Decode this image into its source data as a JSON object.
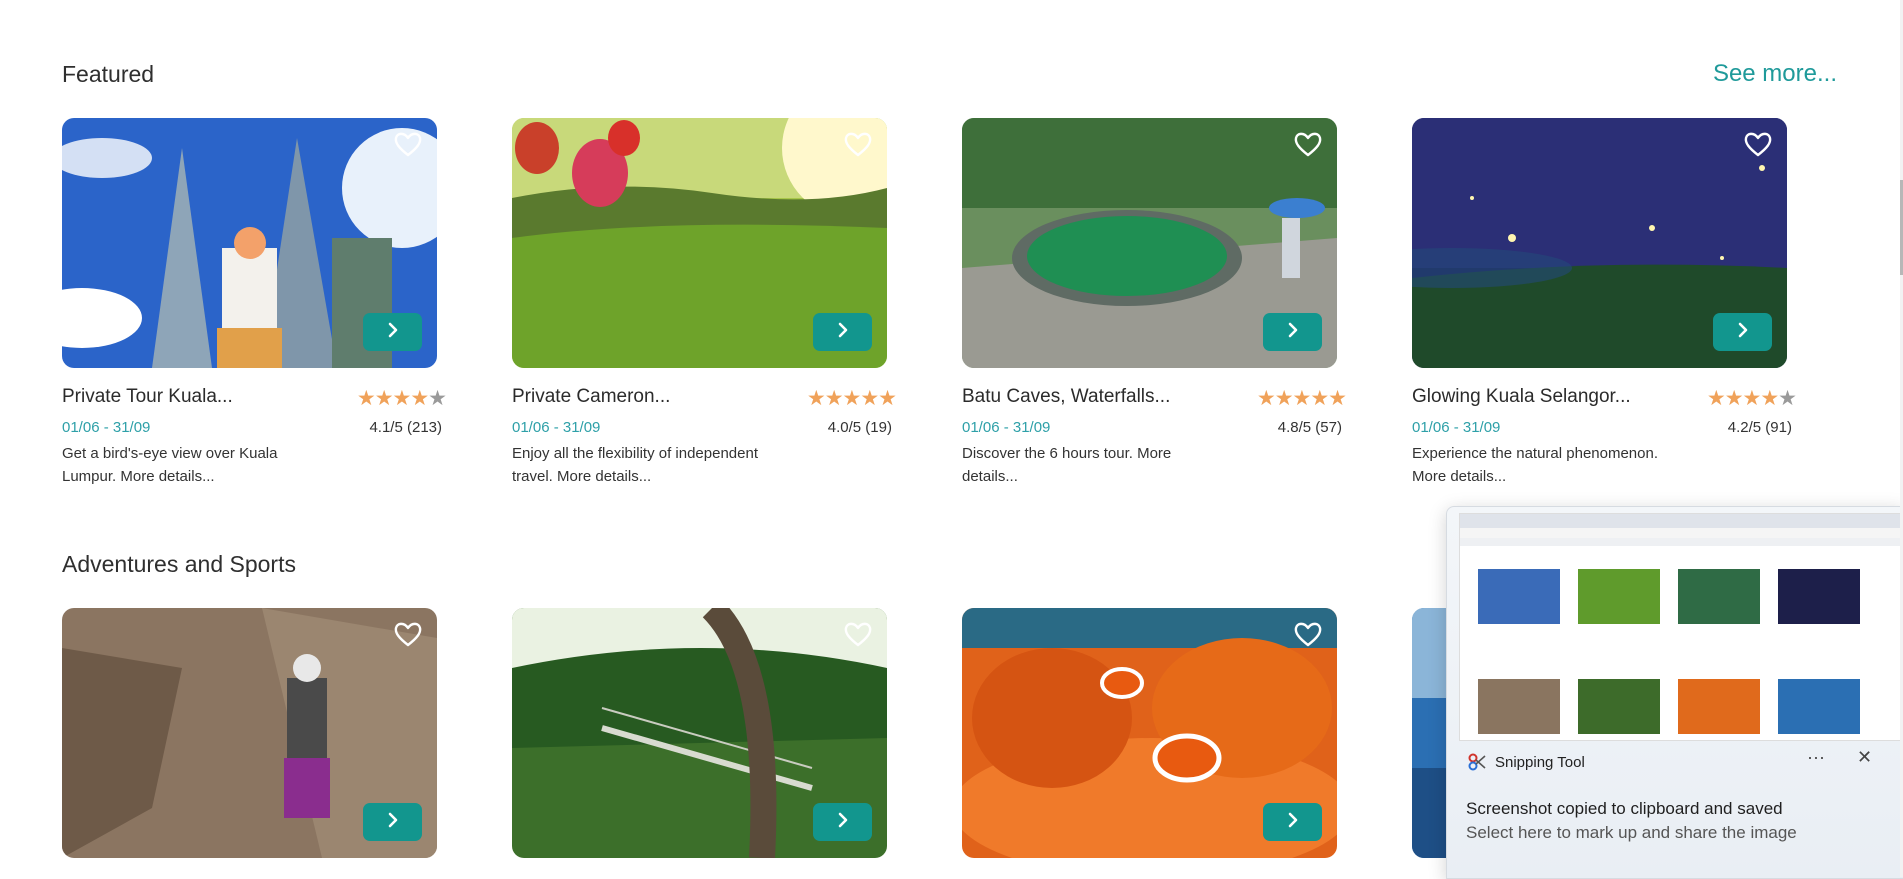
{
  "sections": [
    {
      "title": "Featured",
      "see_more": "See more..."
    },
    {
      "title": "Adventures and Sports"
    }
  ],
  "featured": [
    {
      "title": "Private Tour Kuala...",
      "dates": "01/06 - 31/09",
      "rating": "4.1/5 (213)",
      "stars": 4,
      "desc": "Get a bird's-eye view over Kuala Lumpur. More details...",
      "scene": "towers"
    },
    {
      "title": "Private Cameron...",
      "dates": "01/06 - 31/09",
      "rating": "4.0/5 (19)",
      "stars": 5,
      "desc": "Enjoy all the flexibility of independent travel. More details...",
      "scene": "tea"
    },
    {
      "title": "Batu Caves, Waterfalls...",
      "dates": "01/06 - 31/09",
      "rating": "4.8/5 (57)",
      "stars": 5,
      "desc": "Discover the 6 hours tour. More details...",
      "scene": "pool"
    },
    {
      "title": "Glowing Kuala Selangor...",
      "dates": "01/06 - 31/09",
      "rating": "4.2/5 (91)",
      "stars": 4,
      "desc": "Experience the natural phenomenon. More details...",
      "scene": "night"
    }
  ],
  "adventures": [
    {
      "scene": "climb"
    },
    {
      "scene": "bridge"
    },
    {
      "scene": "reef"
    },
    {
      "scene": "sea"
    }
  ],
  "toast": {
    "app_name": "Snipping Tool",
    "more": "···",
    "close": "✕",
    "message": "Screenshot copied to clipboard and saved",
    "sub": "Select here to mark up and share the image"
  },
  "colors": {
    "accent": "#12968e",
    "link": "#1f9a9a",
    "star": "#f0a25a",
    "date": "#2ea0a8"
  }
}
